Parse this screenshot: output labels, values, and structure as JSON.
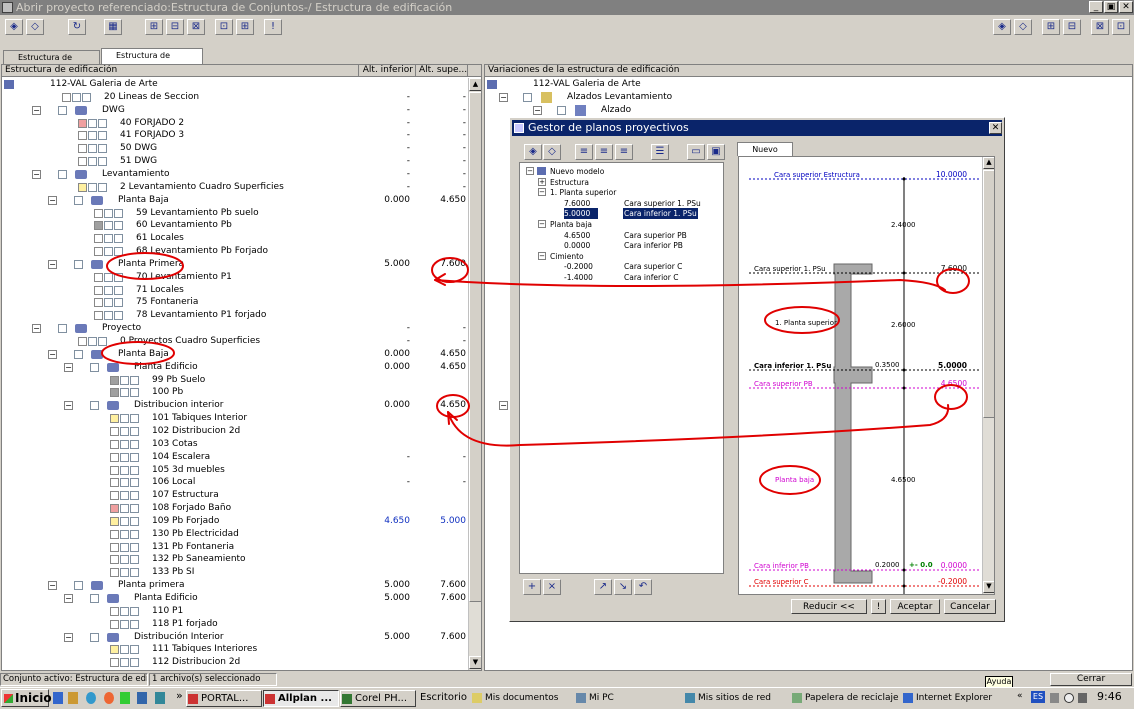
{
  "window": {
    "title": "Abrir proyecto referenciado:Estructura de Conjuntos-/ Estructura de edificación",
    "min": "_",
    "max": "▣",
    "close": "✕"
  },
  "tabs": [
    "Estructura de conjuntos",
    "Estructura de edificación"
  ],
  "left_panel": {
    "col_name": "Estructura de edificación",
    "col_inf": "Alt. inferior",
    "col_sup": "Alt. supe...",
    "rows": [
      {
        "lvl": 0,
        "text": "112-VAL Galeria de Arte",
        "inf": "",
        "sup": "",
        "kind": "root"
      },
      {
        "lvl": 1,
        "text": "20    Lineas de Seccion",
        "inf": "-",
        "sup": "-",
        "kind": "leaf"
      },
      {
        "lvl": 1,
        "text": "DWG",
        "inf": "-",
        "sup": "-",
        "kind": "node"
      },
      {
        "lvl": 2,
        "text": "40    FORJADO 2",
        "inf": "-",
        "sup": "-",
        "kind": "leaf",
        "icon": "red"
      },
      {
        "lvl": 2,
        "text": "41    FORJADO 3",
        "inf": "-",
        "sup": "-",
        "kind": "leaf"
      },
      {
        "lvl": 2,
        "text": "50    DWG",
        "inf": "-",
        "sup": "-",
        "kind": "leaf"
      },
      {
        "lvl": 2,
        "text": "51    DWG",
        "inf": "-",
        "sup": "-",
        "kind": "leaf"
      },
      {
        "lvl": 1,
        "text": "Levantamiento",
        "inf": "-",
        "sup": "-",
        "kind": "node"
      },
      {
        "lvl": 2,
        "text": "2    Levantamiento Cuadro Superficies",
        "inf": "-",
        "sup": "-",
        "kind": "leaf",
        "icon": "yellow"
      },
      {
        "lvl": 2,
        "text": "Planta Baja",
        "inf": "0.000",
        "sup": "4.650",
        "kind": "node"
      },
      {
        "lvl": 3,
        "text": "59    Levantamiento Pb suelo",
        "inf": "",
        "sup": "",
        "kind": "leaf"
      },
      {
        "lvl": 3,
        "text": "60    Levantamiento Pb",
        "inf": "",
        "sup": "",
        "kind": "leaf",
        "icon": "gray"
      },
      {
        "lvl": 3,
        "text": "61    Locales",
        "inf": "",
        "sup": "",
        "kind": "leaf"
      },
      {
        "lvl": 3,
        "text": "68    Levantamiento Pb Forjado",
        "inf": "",
        "sup": "",
        "kind": "leaf"
      },
      {
        "lvl": 2,
        "text": "Planta Primera",
        "inf": "5.000",
        "sup": "7.600",
        "kind": "node"
      },
      {
        "lvl": 3,
        "text": "70    Levantamiento P1",
        "inf": "",
        "sup": "",
        "kind": "leaf"
      },
      {
        "lvl": 3,
        "text": "71    Locales",
        "inf": "",
        "sup": "",
        "kind": "leaf"
      },
      {
        "lvl": 3,
        "text": "75    Fontaneria",
        "inf": "",
        "sup": "",
        "kind": "leaf"
      },
      {
        "lvl": 3,
        "text": "78    Levantamiento P1 forjado",
        "inf": "",
        "sup": "",
        "kind": "leaf"
      },
      {
        "lvl": 1,
        "text": "Proyecto",
        "inf": "-",
        "sup": "-",
        "kind": "node"
      },
      {
        "lvl": 2,
        "text": "0    Proyectos Cuadro Superficies",
        "inf": "-",
        "sup": "-",
        "kind": "leaf"
      },
      {
        "lvl": 2,
        "text": "Planta Baja",
        "inf": "0.000",
        "sup": "4.650",
        "kind": "node"
      },
      {
        "lvl": 3,
        "text": "Planta Edificio",
        "inf": "0.000",
        "sup": "4.650",
        "kind": "node"
      },
      {
        "lvl": 4,
        "text": "99    Pb Suelo",
        "inf": "",
        "sup": "",
        "kind": "leaf",
        "icon": "gray"
      },
      {
        "lvl": 4,
        "text": "100    Pb",
        "inf": "",
        "sup": "",
        "kind": "leaf",
        "icon": "gray"
      },
      {
        "lvl": 3,
        "text": "Distribucion interior",
        "inf": "0.000",
        "sup": "4.650",
        "kind": "node"
      },
      {
        "lvl": 4,
        "text": "101    Tabiques Interior",
        "inf": "",
        "sup": "",
        "kind": "leaf",
        "icon": "yellow"
      },
      {
        "lvl": 4,
        "text": "102    Distribucion 2d",
        "inf": "",
        "sup": "",
        "kind": "leaf"
      },
      {
        "lvl": 4,
        "text": "103    Cotas",
        "inf": "",
        "sup": "",
        "kind": "leaf"
      },
      {
        "lvl": 4,
        "text": "104    Escalera",
        "inf": "-",
        "sup": "-",
        "kind": "leaf"
      },
      {
        "lvl": 4,
        "text": "105    3d muebles",
        "inf": "",
        "sup": "",
        "kind": "leaf"
      },
      {
        "lvl": 4,
        "text": "106    Local",
        "inf": "-",
        "sup": "-",
        "kind": "leaf"
      },
      {
        "lvl": 4,
        "text": "107    Estructura",
        "inf": "",
        "sup": "",
        "kind": "leaf"
      },
      {
        "lvl": 4,
        "text": "108    Forjado Baño",
        "inf": "",
        "sup": "",
        "kind": "leaf",
        "icon": "red"
      },
      {
        "lvl": 4,
        "text": "109    Pb Forjado",
        "inf": "4.650",
        "sup": "5.000",
        "kind": "leaf",
        "icon": "yellow",
        "blue": true
      },
      {
        "lvl": 4,
        "text": "130    Pb Electricidad",
        "inf": "",
        "sup": "",
        "kind": "leaf"
      },
      {
        "lvl": 4,
        "text": "131    Pb Fontaneria",
        "inf": "",
        "sup": "",
        "kind": "leaf"
      },
      {
        "lvl": 4,
        "text": "132    Pb Saneamiento",
        "inf": "",
        "sup": "",
        "kind": "leaf"
      },
      {
        "lvl": 4,
        "text": "133    Pb SI",
        "inf": "",
        "sup": "",
        "kind": "leaf"
      },
      {
        "lvl": 2,
        "text": "Planta primera",
        "inf": "5.000",
        "sup": "7.600",
        "kind": "node"
      },
      {
        "lvl": 3,
        "text": "Planta Edificio",
        "inf": "5.000",
        "sup": "7.600",
        "kind": "node"
      },
      {
        "lvl": 4,
        "text": "110    P1",
        "inf": "",
        "sup": "",
        "kind": "leaf"
      },
      {
        "lvl": 4,
        "text": "118    P1 forjado",
        "inf": "",
        "sup": "",
        "kind": "leaf"
      },
      {
        "lvl": 3,
        "text": "Distribución Interior",
        "inf": "5.000",
        "sup": "7.600",
        "kind": "node"
      },
      {
        "lvl": 4,
        "text": "111    Tabiques Interiores",
        "inf": "",
        "sup": "",
        "kind": "leaf",
        "icon": "yellow"
      },
      {
        "lvl": 4,
        "text": "112    Distribucion 2d",
        "inf": "",
        "sup": "",
        "kind": "leaf"
      }
    ]
  },
  "right_panel": {
    "header": "Variaciones de la estructura de edificación",
    "rows": [
      {
        "lvl": 0,
        "text": "112-VAL Galeria de Arte"
      },
      {
        "lvl": 1,
        "text": "Alzados Levantamiento"
      },
      {
        "lvl": 2,
        "text": "Alzado"
      }
    ]
  },
  "dialog": {
    "title": "Gestor de planos proyectivos",
    "tab": "Nuevo modelo",
    "tree": [
      {
        "lvl": 0,
        "a": "Nuevo modelo",
        "b": ""
      },
      {
        "lvl": 1,
        "a": "Estructura",
        "b": ""
      },
      {
        "lvl": 1,
        "a": "1. Planta superior",
        "b": ""
      },
      {
        "lvl": 2,
        "a": "7.6000",
        "b": "Cara superior 1. PSu"
      },
      {
        "lvl": 2,
        "a": "5.0000",
        "b": "Cara inferior 1. PSu",
        "sel": true
      },
      {
        "lvl": 1,
        "a": "Planta baja",
        "b": ""
      },
      {
        "lvl": 2,
        "a": "4.6500",
        "b": "Cara superior PB"
      },
      {
        "lvl": 2,
        "a": "0.0000",
        "b": "Cara inferior PB"
      },
      {
        "lvl": 1,
        "a": "Cimiento",
        "b": ""
      },
      {
        "lvl": 2,
        "a": "-0.2000",
        "b": "Cara superior C"
      },
      {
        "lvl": 2,
        "a": "-1.4000",
        "b": "Cara inferior C"
      }
    ],
    "drawing": {
      "top_label": "Cara superior Estructura",
      "top_val": "10.0000",
      "dim1": "2.4000",
      "l_psu": "Cara superior 1. PSu",
      "v_psu": "7.6000",
      "planta_sup": "1. Planta superior",
      "dim2": "2.6000",
      "l_inf": "Cara inferior 1. PSu",
      "dim_slab": "0.3500",
      "v_inf": "5.0000",
      "l_pb": "Cara superior PB",
      "v_pb": "4.6500",
      "planta_baja": "Planta baja",
      "dim3": "4.6500",
      "l_infpb": "Cara inferior PB",
      "dim_base": "0.2000",
      "zero_mark": "+- 0.0",
      "v_infpb": "0.0000",
      "l_supc": "Cara superior C",
      "v_supc": "-0.2000"
    },
    "buttons": {
      "reducir": "Reducir <<",
      "aceptar": "Aceptar",
      "cancelar": "Cancelar"
    }
  },
  "status": {
    "seg1": "Conjunto activo: Estructura de edificac",
    "seg2": "1 archivo(s) seleccionado",
    "ayuda": "Ayuda",
    "cerrar": "Cerrar"
  },
  "taskbar": {
    "start": "Inicio",
    "tasks": [
      "PORTAL...",
      "Allplan ...",
      "Corel PH...",
      "Escritorio",
      "Mis documentos",
      "Mi PC",
      "Mis sitios de red",
      "Papelera de reciclaje",
      "Internet Explorer"
    ],
    "lang": "ES",
    "time": "9:46"
  }
}
